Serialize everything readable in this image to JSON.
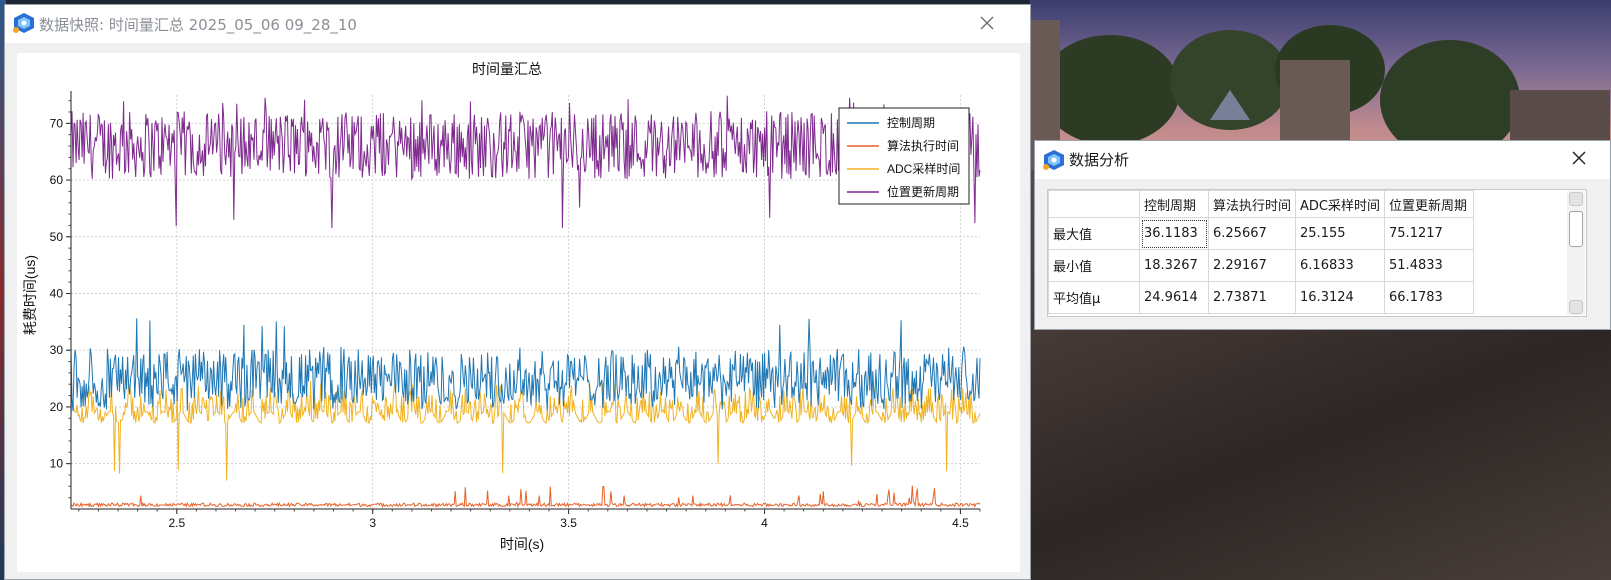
{
  "main_window": {
    "title": "数据快照: 时间量汇总 2025_05_06 09_28_10"
  },
  "chart_data": {
    "type": "line",
    "title": "时间量汇总",
    "xlabel": "时间(s)",
    "ylabel": "耗费时间(us)",
    "xlim": [
      2.23,
      4.55
    ],
    "ylim": [
      2,
      75
    ],
    "xticks": [
      "2.5",
      "3",
      "3.5",
      "4",
      "4.5"
    ],
    "xtick_values": [
      2.5,
      3,
      3.5,
      4,
      4.5
    ],
    "yticks": [
      "10",
      "20",
      "30",
      "40",
      "50",
      "60",
      "70"
    ],
    "ytick_values": [
      10,
      20,
      30,
      40,
      50,
      60,
      70
    ],
    "grid": true,
    "legend_position": "top-right",
    "series": [
      {
        "name": "控制周期",
        "color": "#1f77b4",
        "mean": 24.9614,
        "min": 18.3267,
        "max": 36.1183
      },
      {
        "name": "算法执行时间",
        "color": "#e8622a",
        "mean": 2.73871,
        "min": 2.29167,
        "max": 6.25667
      },
      {
        "name": "ADC采样时间",
        "color": "#f0b323",
        "mean": 16.3124,
        "min": 6.16833,
        "max": 25.155
      },
      {
        "name": "位置更新周期",
        "color": "#7e2a8e",
        "mean": 66.1783,
        "min": 51.4833,
        "max": 75.1217
      }
    ]
  },
  "analysis_window": {
    "title": "数据分析",
    "table": {
      "columns": [
        "控制周期",
        "算法执行时间",
        "ADC采样时间",
        "位置更新周期"
      ],
      "rows": [
        {
          "label": "最大值",
          "values": [
            "36.1183",
            "6.25667",
            "25.155",
            "75.1217"
          ]
        },
        {
          "label": "最小值",
          "values": [
            "18.3267",
            "2.29167",
            "6.16833",
            "51.4833"
          ]
        },
        {
          "label": "平均值μ",
          "values": [
            "24.9614",
            "2.73871",
            "16.3124",
            "66.1783"
          ]
        }
      ]
    }
  },
  "icons": {
    "app": "app-logo-icon",
    "close": "close-icon"
  }
}
